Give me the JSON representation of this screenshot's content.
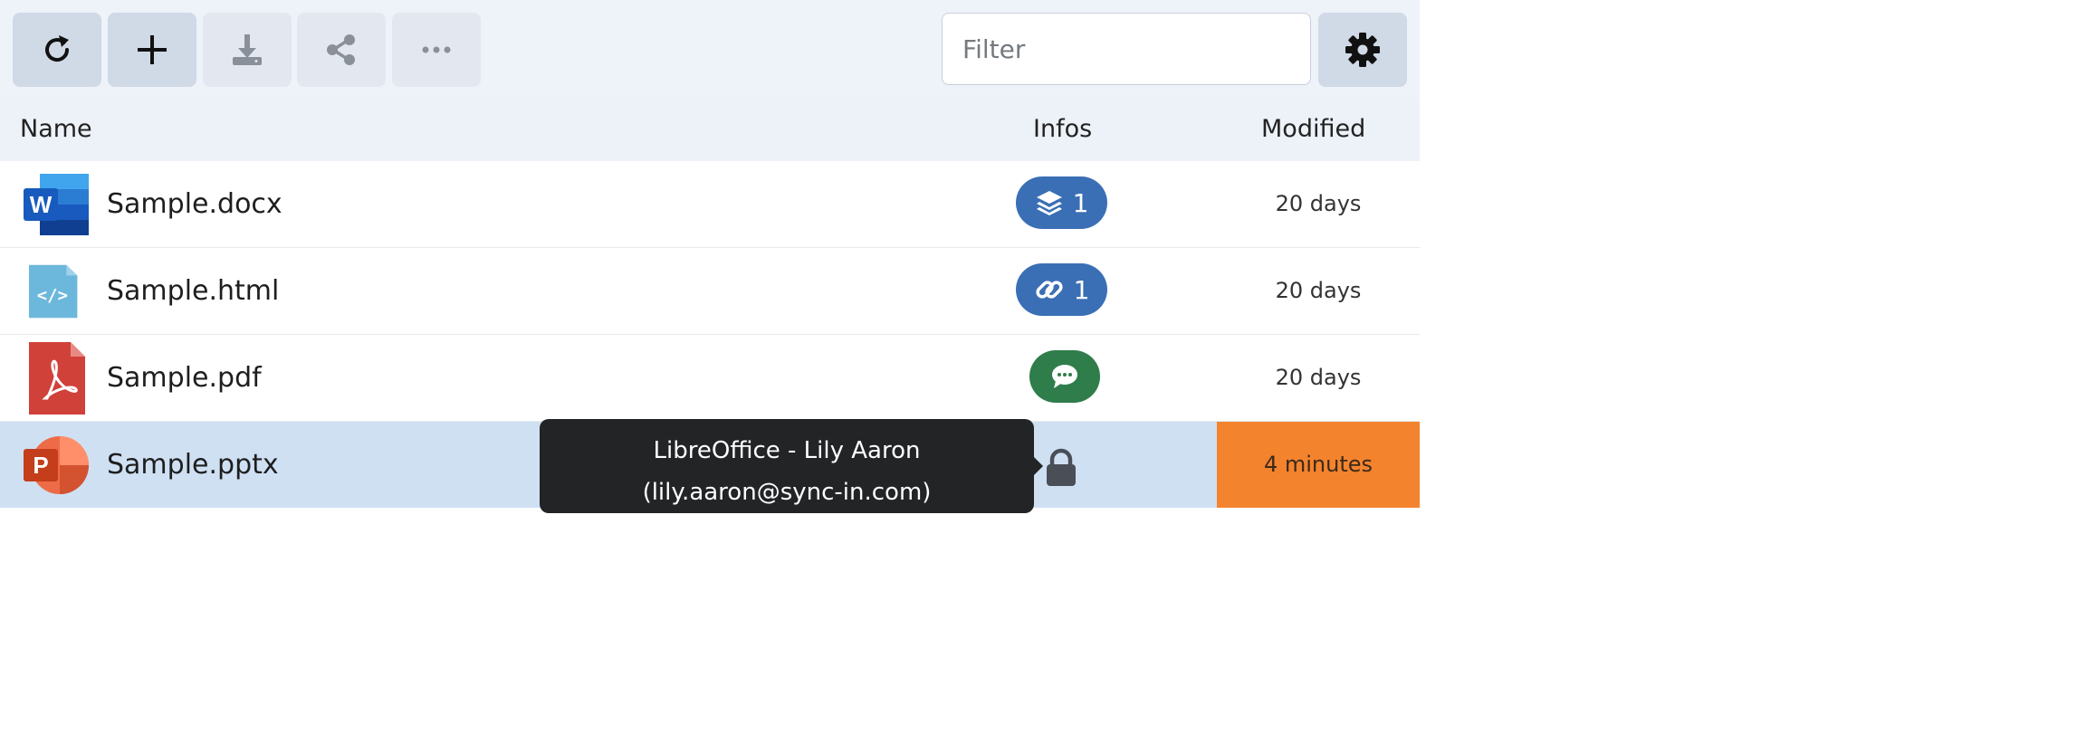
{
  "toolbar": {
    "buttons": [
      {
        "icon": "refresh-icon",
        "enabled": true
      },
      {
        "icon": "plus-icon",
        "enabled": true
      },
      {
        "icon": "download-icon",
        "enabled": false
      },
      {
        "icon": "share-icon",
        "enabled": false
      },
      {
        "icon": "more-icon",
        "enabled": false
      }
    ],
    "filter_placeholder": "Filter",
    "settings_icon": "gear-icon"
  },
  "table": {
    "columns": {
      "name": "Name",
      "infos": "Infos",
      "modified": "Modified"
    },
    "rows": [
      {
        "name": "Sample.docx",
        "icon": "word-file-icon",
        "badge": {
          "icon": "layers-icon",
          "count": "1",
          "color": "#3a6fb5"
        },
        "modified": "20 days"
      },
      {
        "name": "Sample.html",
        "icon": "html-file-icon",
        "badge": {
          "icon": "link-icon",
          "count": "1",
          "color": "#3a6fb5"
        },
        "modified": "20 days"
      },
      {
        "name": "Sample.pdf",
        "icon": "pdf-file-icon",
        "badge": {
          "icon": "comment-icon",
          "count": "",
          "color": "#2f7d4b"
        },
        "modified": "20 days"
      },
      {
        "name": "Sample.pptx",
        "icon": "powerpoint-file-icon",
        "badge": {
          "icon": "lock-icon"
        },
        "modified": "4 minutes",
        "selected": true
      }
    ]
  },
  "tooltip": {
    "line1": "LibreOffice - Lily Aaron",
    "line2": "(lily.aaron@sync-in.com)"
  },
  "colors": {
    "selected_row": "#cfe0f3",
    "modified_highlight": "#f4832e",
    "badge_blue": "#3a6fb5",
    "badge_green": "#2f7d4b"
  }
}
